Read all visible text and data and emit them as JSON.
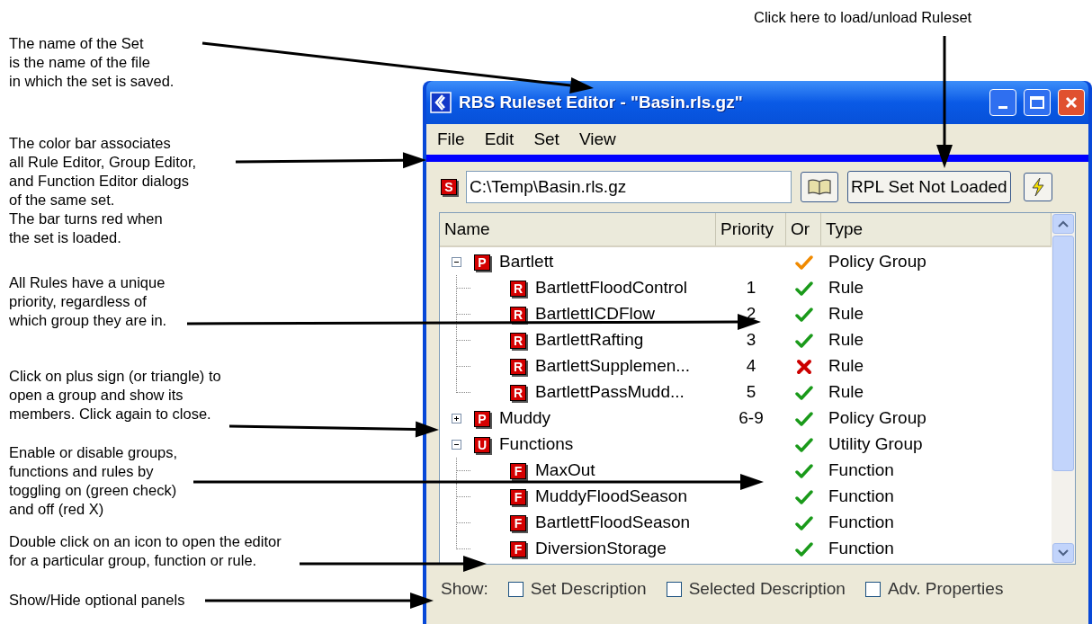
{
  "annotations": [
    {
      "lines": [
        "The name of the Set",
        "is the name of the file",
        "in which the set is saved."
      ]
    },
    {
      "lines": [
        "Click here to load/unload Ruleset"
      ]
    },
    {
      "lines": [
        "The color bar associates",
        "all Rule Editor, Group Editor,",
        "and Function Editor dialogs",
        "of the same set.",
        "The bar turns red when",
        "the set is loaded."
      ]
    },
    {
      "lines": [
        "All Rules have a unique",
        "priority, regardless of",
        "which group they are in."
      ]
    },
    {
      "lines": [
        "Click on plus sign (or triangle) to",
        "open a group and show its",
        "members. Click again to close."
      ]
    },
    {
      "lines": [
        "Enable or disable groups,",
        "functions and rules by",
        "toggling on (green check)",
        "and off (red X)"
      ]
    },
    {
      "lines": [
        "Double click on an icon to open the editor",
        "for a particular group, function or rule."
      ]
    },
    {
      "lines": [
        "Show/Hide optional panels"
      ]
    }
  ],
  "window": {
    "title": "RBS Ruleset Editor - \"Basin.rls.gz\"",
    "menu": [
      "File",
      "Edit",
      "Set",
      "View"
    ],
    "color_bar": {
      "color": "#0000ff"
    },
    "set_icon": "S",
    "path_field": {
      "value": "C:\\Temp\\Basin.rls.gz"
    },
    "load_button": "RPL Set Not Loaded",
    "tree": {
      "columns": [
        "Name",
        "Priority",
        "Or",
        "Type"
      ],
      "items": [
        {
          "badge": "P",
          "name": "Bartlett",
          "enabled": true,
          "partial": true,
          "type": "Policy Group",
          "expanded": true,
          "children": [
            {
              "badge": "R",
              "name": "BartlettFloodControl",
              "priority": "1",
              "enabled": true,
              "partial": false,
              "type": "Rule"
            },
            {
              "badge": "R",
              "name": "BartlettICDFlow",
              "priority": "2",
              "enabled": true,
              "partial": false,
              "type": "Rule"
            },
            {
              "badge": "R",
              "name": "BartlettRafting",
              "priority": "3",
              "enabled": true,
              "partial": false,
              "type": "Rule"
            },
            {
              "badge": "R",
              "name": "BartlettSupplemen...",
              "priority": "4",
              "enabled": false,
              "partial": false,
              "type": "Rule"
            },
            {
              "badge": "R",
              "name": "BartlettPassMudd...",
              "priority": "5",
              "enabled": true,
              "partial": false,
              "type": "Rule"
            }
          ]
        },
        {
          "badge": "P",
          "name": "Muddy",
          "priority": "6-9",
          "enabled": true,
          "partial": false,
          "type": "Policy Group",
          "expanded": false
        },
        {
          "badge": "U",
          "name": "Functions",
          "enabled": true,
          "partial": false,
          "type": "Utility Group",
          "expanded": true,
          "children": [
            {
              "badge": "F",
              "name": "MaxOut",
              "enabled": true,
              "partial": false,
              "type": "Function"
            },
            {
              "badge": "F",
              "name": "MuddyFloodSeason",
              "enabled": true,
              "partial": false,
              "type": "Function"
            },
            {
              "badge": "F",
              "name": "BartlettFloodSeason",
              "enabled": true,
              "partial": false,
              "type": "Function"
            },
            {
              "badge": "F",
              "name": "DiversionStorage",
              "enabled": true,
              "partial": false,
              "type": "Function"
            }
          ]
        }
      ]
    },
    "show_bar": {
      "label": "Show:",
      "options": [
        {
          "label": "Set Description",
          "checked": false
        },
        {
          "label": "Selected Description",
          "checked": false
        },
        {
          "label": "Adv. Properties",
          "checked": false
        }
      ]
    }
  }
}
